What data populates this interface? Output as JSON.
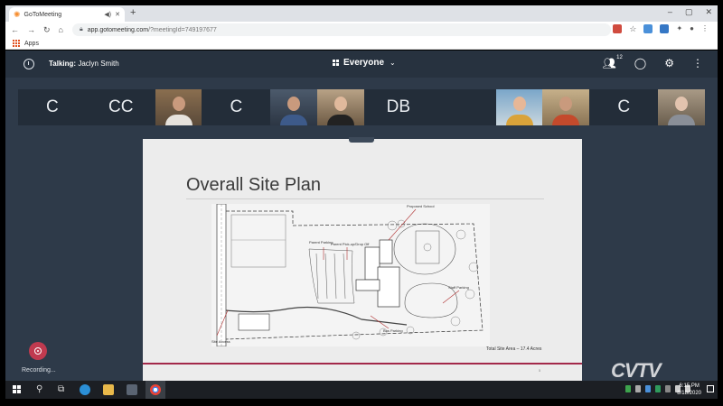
{
  "browser": {
    "tab_title": "GoToMeeting",
    "url_host": "app.gotomeeting.com",
    "url_query": "/?meetingId=749197677",
    "bookmarks_apps": "Apps",
    "new_tab_glyph": "+",
    "window_controls": [
      "–",
      "▢",
      "✕"
    ]
  },
  "meeting": {
    "talking_label": "Talking:",
    "talking_name": "Jaclyn Smith",
    "view_label": "Everyone",
    "attendee_count": "12"
  },
  "participants": [
    {
      "kind": "initials",
      "label": "C"
    },
    {
      "kind": "initials",
      "label": "CC"
    },
    {
      "kind": "video",
      "label": ""
    },
    {
      "kind": "initials",
      "label": "C"
    },
    {
      "kind": "video",
      "label": ""
    },
    {
      "kind": "video",
      "label": ""
    },
    {
      "kind": "initials",
      "label": "DB"
    },
    {
      "kind": "blank",
      "label": ""
    },
    {
      "kind": "video",
      "label": ""
    },
    {
      "kind": "video",
      "label": ""
    },
    {
      "kind": "initials",
      "label": "C"
    },
    {
      "kind": "video",
      "label": ""
    }
  ],
  "slide": {
    "title": "Overall Site Plan",
    "area_note": "Total Site Area – 17.4 Acres",
    "page_number": "5",
    "plan_labels": {
      "proposed_school": "Proposed School",
      "parent_parking": "Parent Parking",
      "parent_pickup": "Parent Pick-up/Drop Off",
      "staff_parking": "Staff Parking",
      "bus_parking": "Bus Parking",
      "site_access": "Site Access"
    }
  },
  "recording_label": "Recording...",
  "watermark": "CVTV",
  "taskbar": {
    "time": "6:15 PM",
    "date": "8/18/2020"
  },
  "colors": {
    "app_bg": "#2e3a49",
    "topbar_bg": "#27323f",
    "tile_bg": "#232d39",
    "slide_accent": "#a3294a",
    "record_red": "#c03a4f"
  }
}
